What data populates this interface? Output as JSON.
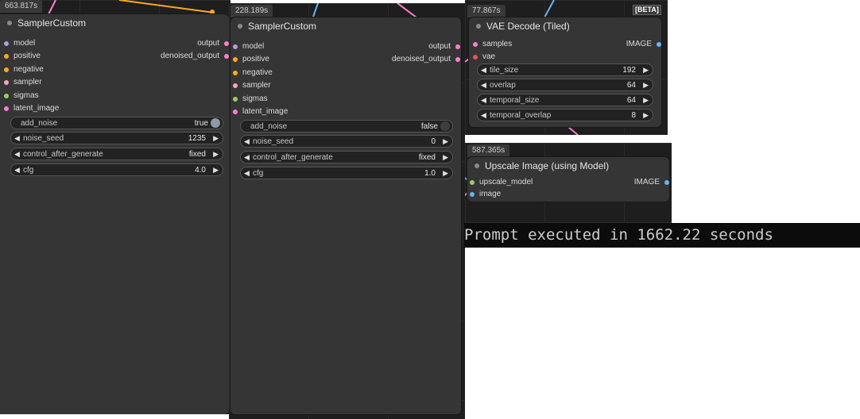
{
  "panel_left": {
    "timing": "663.817s",
    "node": {
      "title": "SamplerCustom",
      "inputs": [
        {
          "label": "model",
          "color": "#b39ddb"
        },
        {
          "label": "positive",
          "color": "#ffa726"
        },
        {
          "label": "negative",
          "color": "#ffa726"
        },
        {
          "label": "sampler",
          "color": "#f4a6b6"
        },
        {
          "label": "sigmas",
          "color": "#9ccc65"
        },
        {
          "label": "latent_image",
          "color": "#ff7fd2"
        }
      ],
      "outputs": [
        {
          "label": "output",
          "color": "#ff7fd2"
        },
        {
          "label": "denoised_output",
          "color": "#ff7fd2"
        }
      ],
      "add_noise": {
        "label": "add_noise",
        "value": "true"
      },
      "widgets": [
        {
          "label": "noise_seed",
          "value": "1235"
        },
        {
          "label": "control_after_generate",
          "value": "fixed"
        },
        {
          "label": "cfg",
          "value": "4.0"
        }
      ]
    }
  },
  "panel_middle": {
    "timing": "228.189s",
    "node": {
      "title": "SamplerCustom",
      "inputs": [
        {
          "label": "model",
          "color": "#b39ddb"
        },
        {
          "label": "positive",
          "color": "#ffa726"
        },
        {
          "label": "negative",
          "color": "#ffa726"
        },
        {
          "label": "sampler",
          "color": "#f4a6b6"
        },
        {
          "label": "sigmas",
          "color": "#9ccc65"
        },
        {
          "label": "latent_image",
          "color": "#ff7fd2"
        }
      ],
      "outputs": [
        {
          "label": "output",
          "color": "#ff7fd2"
        },
        {
          "label": "denoised_output",
          "color": "#ff7fd2"
        }
      ],
      "add_noise": {
        "label": "add_noise",
        "value": "false"
      },
      "widgets": [
        {
          "label": "noise_seed",
          "value": "0"
        },
        {
          "label": "control_after_generate",
          "value": "fixed"
        },
        {
          "label": "cfg",
          "value": "1.0"
        }
      ]
    }
  },
  "panel_vae": {
    "timing": "77.867s",
    "badge": "[BETA]",
    "node": {
      "title": "VAE Decode (Tiled)",
      "inputs": [
        {
          "label": "samples",
          "color": "#ff7fd2"
        },
        {
          "label": "vae",
          "color": "#ef5350"
        }
      ],
      "output": {
        "label": "IMAGE",
        "color": "#64b5f6"
      },
      "widgets": [
        {
          "label": "tile_size",
          "value": "192"
        },
        {
          "label": "overlap",
          "value": "64"
        },
        {
          "label": "temporal_size",
          "value": "64"
        },
        {
          "label": "temporal_overlap",
          "value": "8"
        }
      ]
    }
  },
  "panel_upscale": {
    "timing": "587.365s",
    "node": {
      "title": "Upscale Image (using Model)",
      "inputs": [
        {
          "label": "upscale_model",
          "color": "#9ccc65"
        },
        {
          "label": "image",
          "color": "#64b5f6"
        }
      ],
      "output": {
        "label": "IMAGE",
        "color": "#64b5f6"
      }
    }
  },
  "console": {
    "message": "Prompt executed in 1662.22 seconds"
  },
  "colors": {
    "node_bg": "#353535",
    "canvas_bg": "#1e1e1e",
    "toggle_on": "#8f9aa6",
    "toggle_off": "#3e3e3e",
    "link_orange": "#ffa726",
    "link_blue": "#64b5f6",
    "link_pink": "#ff7fd2"
  }
}
